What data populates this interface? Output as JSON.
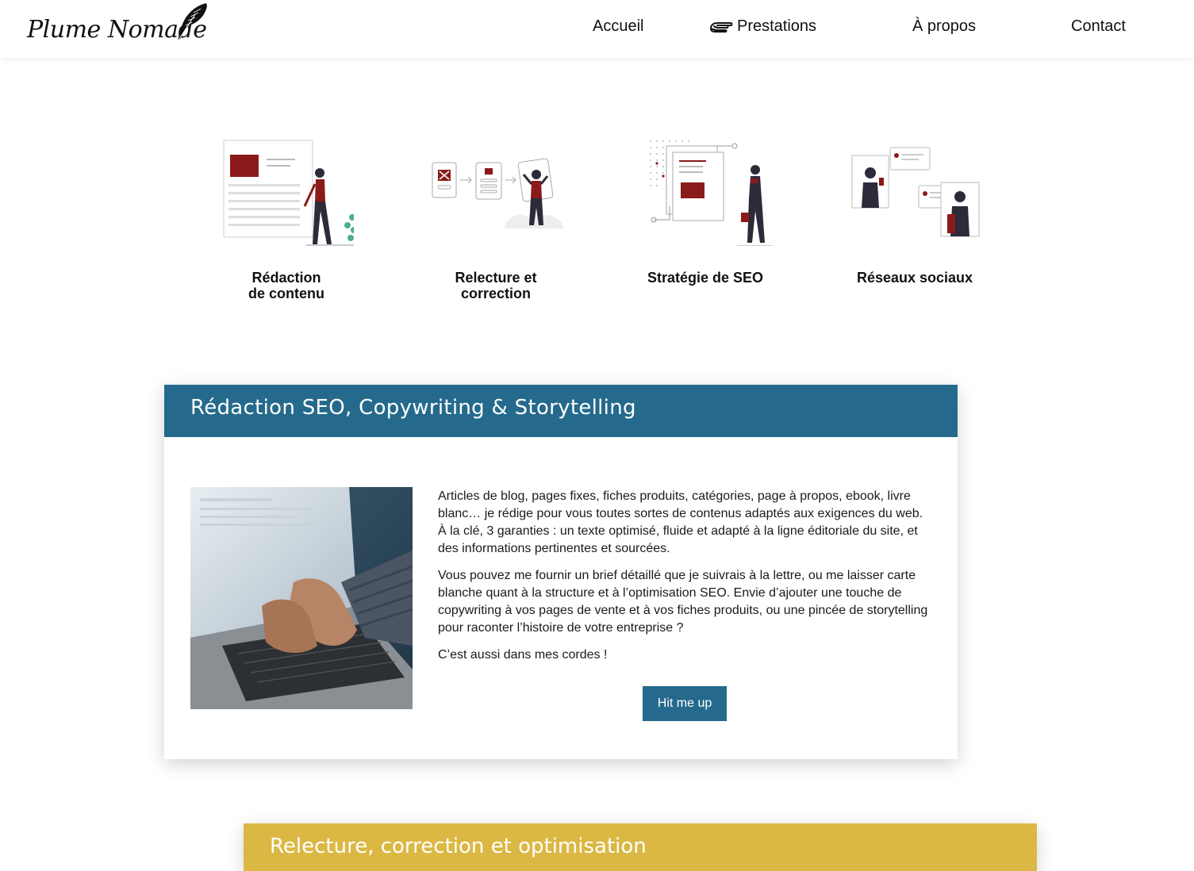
{
  "brand": {
    "logo_text": "Plume Nomade"
  },
  "nav": {
    "items": [
      {
        "label": "Accueil"
      },
      {
        "label": "Prestations"
      },
      {
        "label": "À propos"
      },
      {
        "label": "Contact"
      }
    ]
  },
  "services": [
    {
      "label": "Rédaction de contenu"
    },
    {
      "label": "Relecture et correction"
    },
    {
      "label": "Stratégie de SEO"
    },
    {
      "label": "Réseaux sociaux"
    }
  ],
  "section1": {
    "title": "Rédaction SEO, Copywriting & Storytelling",
    "paragraphs": [
      "Articles de blog, pages fixes, fiches produits, catégories, page à propos, ebook, livre blanc… je rédige pour vous toutes sortes de contenus adaptés aux exigences du web. À la clé, 3 garanties : un texte optimisé, fluide et adapté à la ligne éditoriale du site, et des informations pertinentes et sourcées.",
      "Vous pouvez me fournir un brief détaillé que je suivrais à la lettre, ou me laisser carte blanche quant à la structure et à l’optimisation SEO. Envie d’ajouter une touche de copywriting à vos pages de vente et à vos fiches produits, ou une pincée de storytelling pour raconter l’histoire de votre entreprise ?",
      "C’est aussi dans mes cordes !"
    ],
    "button_label": "Hit me up"
  },
  "section2": {
    "title": "Relecture, correction et optimisation"
  },
  "colors": {
    "primary": "#256a8c",
    "accent_red": "#8b1a1a",
    "yellow": "#dbb843",
    "teal_green": "#4caf8a"
  },
  "icons": {
    "logo": "feather-icon",
    "nav_active": "pointing-hand-icon"
  }
}
